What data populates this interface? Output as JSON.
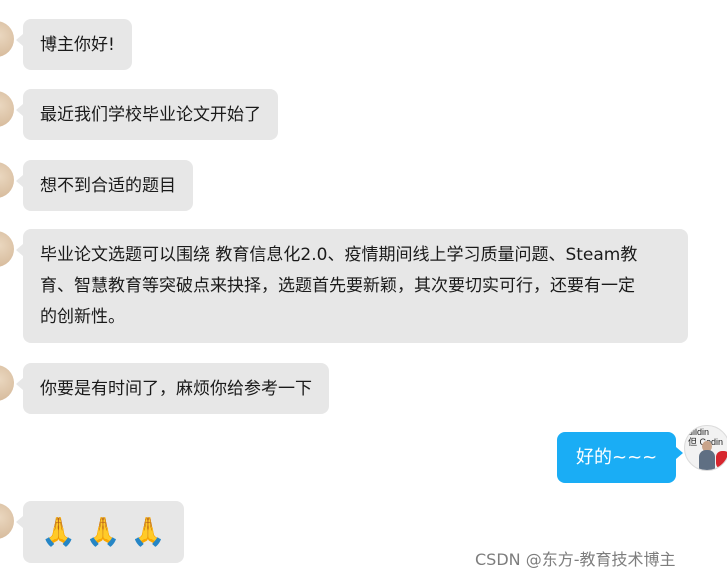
{
  "top_stub": "········",
  "messages": [
    {
      "side": "left",
      "text": "博主你好!"
    },
    {
      "side": "left",
      "text": "最近我们学校毕业论文开始了"
    },
    {
      "side": "left",
      "text": "想不到合适的题目"
    },
    {
      "side": "left",
      "lines": [
        "毕业论文选题可以围绕 教育信息化2.0、疫情期间线上学习质量问题、Steam教",
        "育、智慧教育等突破点来抉择，选题首先要新颖，其次要切实可行，还要有一定",
        "的创新性。"
      ]
    },
    {
      "side": "left",
      "text": "你要是有时间了，麻烦你给参考一下"
    },
    {
      "side": "right",
      "text": "好的~~~"
    },
    {
      "side": "left",
      "emoji": [
        "🙏",
        "🙏",
        "🙏"
      ]
    }
  ],
  "right_avatar": {
    "text_line1": "uildin",
    "text_line2": "但 Codin"
  },
  "watermark": "CSDN @东方-教育技术博主",
  "colors": {
    "bubble_left": "#e7e7e7",
    "bubble_right": "#1aadf5",
    "background": "#ffffff"
  },
  "icons": {
    "left_avatar": "user-avatar-icon",
    "right_avatar": "user-avatar-icon",
    "emoji": "praying-hands-emoji"
  }
}
